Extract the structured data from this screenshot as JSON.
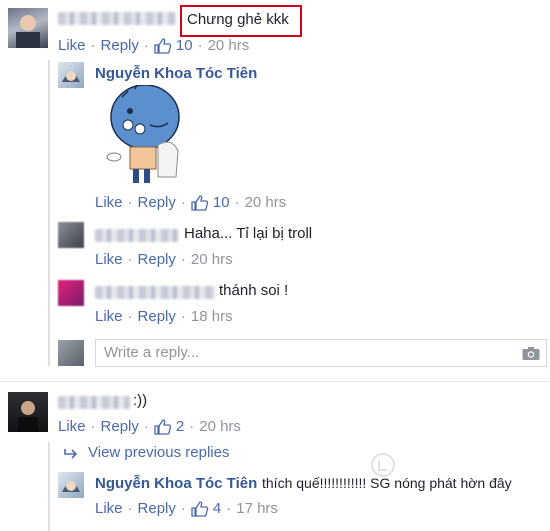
{
  "colors": {
    "link": "#365899",
    "meta": "#90949c",
    "highlight": "#d0021b"
  },
  "comment1": {
    "text": "Chưng ghẻ kkk",
    "actions": {
      "like": "Like",
      "reply": "Reply",
      "likes": "10",
      "time": "20 hrs"
    }
  },
  "reply1": {
    "author": "Nguyễn Khoa Tóc Tiên",
    "sticker": "toilet-character-sticker",
    "actions": {
      "like": "Like",
      "reply": "Reply",
      "likes": "10",
      "time": "20 hrs"
    }
  },
  "reply2": {
    "text": "Haha... Tỉ lại bị troll",
    "actions": {
      "like": "Like",
      "reply": "Reply",
      "time": "20 hrs"
    }
  },
  "reply3": {
    "text": "thánh soi !",
    "actions": {
      "like": "Like",
      "reply": "Reply",
      "time": "18 hrs"
    }
  },
  "reply_box": {
    "placeholder": "Write a reply...",
    "icon": "camera-icon"
  },
  "comment2": {
    "text": ":))",
    "actions": {
      "like": "Like",
      "reply": "Reply",
      "likes": "2",
      "time": "20 hrs"
    }
  },
  "view_previous": "View previous replies",
  "reply4": {
    "author": "Nguyễn Khoa Tóc Tiên",
    "text": "thích quế!!!!!!!!!!!! SG nóng phát hờn đây",
    "actions": {
      "like": "Like",
      "reply": "Reply",
      "likes": "4",
      "time": "17 hrs"
    }
  }
}
